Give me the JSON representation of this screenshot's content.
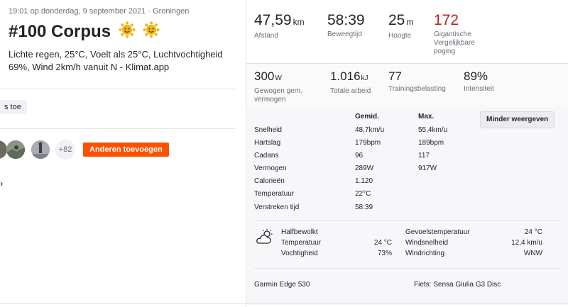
{
  "activity": {
    "meta": "19:01 op donderdag, 9 september 2021 · Groningen",
    "title": "#100 Corpus",
    "description": "Lichte regen, 25°C, Voelt als 25°C, Luchtvochtigheid 69%, Wind 2km/h vanuit N - Klimat.app",
    "pill_label": "s toe",
    "kudos_more": "+82",
    "add_others_label": "Anderen toevoegen",
    "chevron": "›"
  },
  "stats_primary": [
    {
      "value": "47,59",
      "unit": "km",
      "label": "Afstand"
    },
    {
      "value": "58:39",
      "unit": "",
      "label": "Beweegtijd"
    },
    {
      "value": "25",
      "unit": "m",
      "label": "Hoogte"
    },
    {
      "value": "172",
      "unit": "",
      "label": "Gigantische Vergelijkbare poging"
    }
  ],
  "stats_secondary": [
    {
      "value": "300",
      "unit": "W",
      "label": "Gewogen gem. vermogen"
    },
    {
      "value": "1.016",
      "unit": "kJ",
      "label": "Totale arbeid"
    },
    {
      "value": "77",
      "unit": "",
      "label": "Trainingsbelasting"
    },
    {
      "value": "89%",
      "unit": "",
      "label": "Intensiteit"
    }
  ],
  "details": {
    "header_avg": "Gemid.",
    "header_max": "Max.",
    "less_button": "Minder weergeven",
    "rows": [
      {
        "name": "Snelheid",
        "avg": "48,7km/u",
        "max": "55,4km/u"
      },
      {
        "name": "Hartslag",
        "avg": "179bpm",
        "max": "189bpm"
      },
      {
        "name": "Cadans",
        "avg": "96",
        "max": "117"
      },
      {
        "name": "Vermogen",
        "avg": "289W",
        "max": "917W"
      },
      {
        "name": "Calorieën",
        "avg": "1.120",
        "max": ""
      },
      {
        "name": "Temperatuur",
        "avg": "22°C",
        "max": ""
      },
      {
        "name": "Verstreken tijd",
        "avg": "58:39",
        "max": ""
      }
    ]
  },
  "weather": {
    "icon": "partly-cloudy-icon",
    "condition": "Halfbewolkt",
    "temp_label": "Temperatuur",
    "temp_value": "24 °C",
    "humidity_label": "Vochtigheid",
    "humidity_value": "73%",
    "feels_label": "Gevoelstemperatuur",
    "feels_value": "24 °C",
    "wind_label": "Windsnelheid",
    "wind_value": "12,4 km/u",
    "dir_label": "Windrichting",
    "dir_value": "WNW"
  },
  "device": {
    "device_name": "Garmin Edge 530",
    "bike": "Fiets: Sensa Giulia G3 Disc"
  },
  "colors": {
    "accent": "#fc5200",
    "record_red": "#b8231f"
  }
}
